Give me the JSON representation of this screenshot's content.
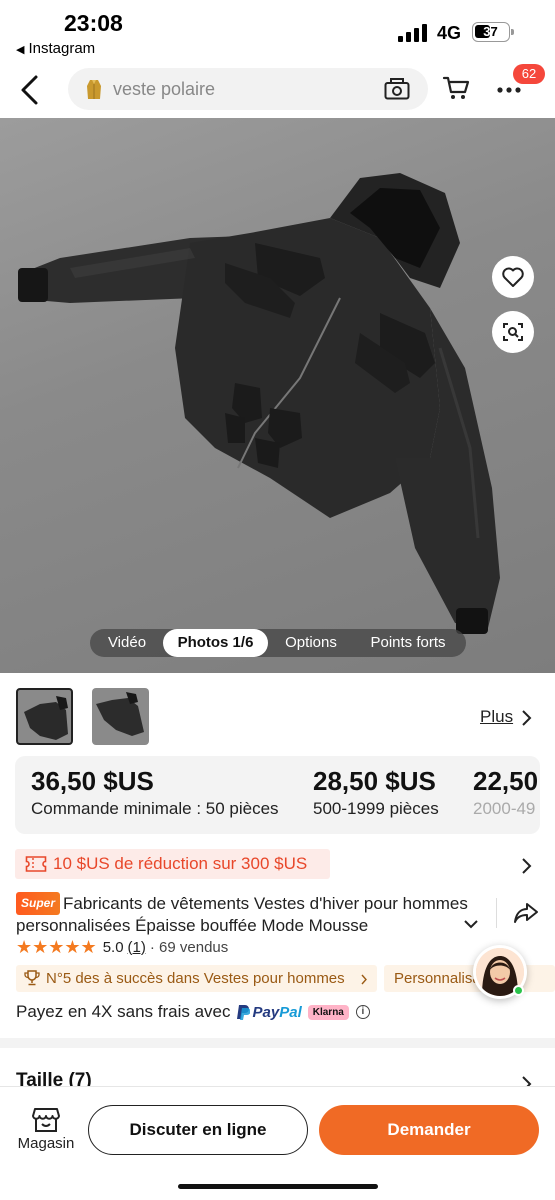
{
  "status_bar": {
    "time": "23:08",
    "back_app": "Instagram",
    "network": "4G",
    "battery": "37"
  },
  "header": {
    "search_placeholder": "veste polaire",
    "cart_badge": "62",
    "icons": [
      "back-chevron-icon",
      "camera-search-icon",
      "cart-icon",
      "more-icon"
    ]
  },
  "media": {
    "tabs": [
      {
        "label": "Vidéo",
        "active": false
      },
      {
        "label": "Photos 1/6",
        "active": true
      },
      {
        "label": "Options",
        "active": false
      },
      {
        "label": "Points forts",
        "active": false
      }
    ],
    "more_label": "Plus"
  },
  "prices": [
    {
      "price": "36,50 $US",
      "qty": "Commande minimale : 50 pièces"
    },
    {
      "price": "28,50 $US",
      "qty": "500-1999 pièces"
    },
    {
      "price": "22,50",
      "qty": "2000-49"
    }
  ],
  "promo": {
    "text": "10 $US de réduction sur 300 $US"
  },
  "product": {
    "super_badge": "Super",
    "title": "Fabricants de vêtements Vestes d'hiver pour hommes personnalisées Épaisse bouffée Mode Mousse",
    "rating": "5.0",
    "rating_count": "(1)",
    "sold": "· 69 vendus",
    "stars": 5
  },
  "chips": {
    "rank": "N°5 des à succès dans Vestes pour hommes",
    "custom": "Personnalisation"
  },
  "payment": {
    "text": "Payez en 4X sans frais avec",
    "paypal_pay": "Pay",
    "paypal_pal": "Pal",
    "klarna": "Klarna"
  },
  "size_section": {
    "label": "Taille (7)"
  },
  "bottom_bar": {
    "store_label": "Magasin",
    "chat_label": "Discuter en ligne",
    "ask_label": "Demander"
  },
  "colors": {
    "accent": "#f06a25",
    "badge": "#f5473b",
    "promo_text": "#e8472a",
    "chip_text": "#9a5a14",
    "star": "#f47a20"
  }
}
